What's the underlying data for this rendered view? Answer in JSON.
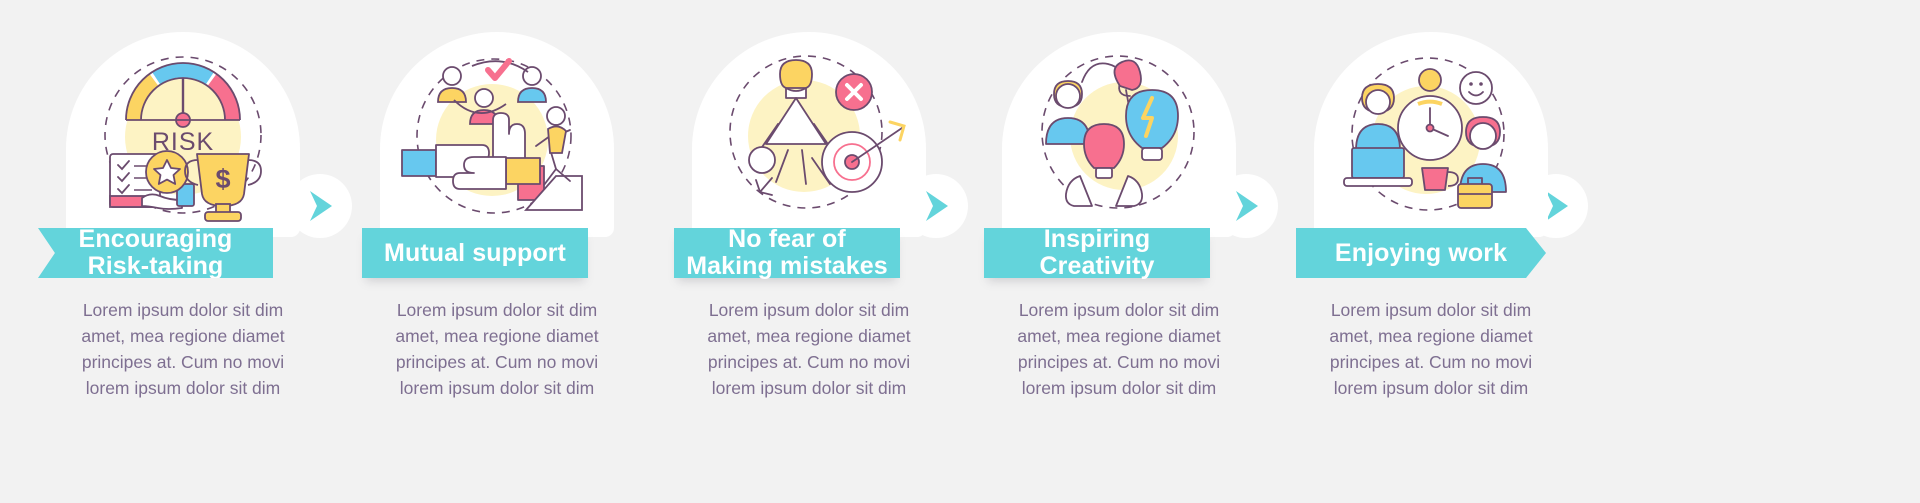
{
  "background_color": "#f2f2f2",
  "theme": {
    "accent_teal": "#63d4db",
    "banner_text_color": "#ffffff",
    "body_text_color": "#7e6f91",
    "card_color": "#ffffff",
    "yellow": "#fcd462",
    "pink": "#f7708f",
    "blue": "#67c8ef",
    "outline": "#6b4b6e",
    "soft_yellow": "#fdf3c4"
  },
  "shared": {
    "body_text": "Lorem ipsum dolor sit dim amet, mea regione diamet principes at. Cum no movi lorem ipsum dolor sit dim"
  },
  "steps": [
    {
      "index": 1,
      "label_lines": [
        "Encouraging",
        "Risk-taking"
      ],
      "label_plain": "Encouraging Risk-taking",
      "icon_name": "risk-gauge-trophy-illustration",
      "icon_caption": "RISK",
      "banner_shape": "left-notch",
      "body_text": "Lorem ipsum dolor sit dim amet, mea regione diamet principes at. Cum no movi lorem ipsum dolor sit dim"
    },
    {
      "index": 2,
      "label_lines": [
        "Mutual support"
      ],
      "label_plain": "Mutual support",
      "icon_name": "teamwork-hands-illustration",
      "icon_caption": "",
      "banner_shape": "rect",
      "body_text": "Lorem ipsum dolor sit dim amet, mea regione diamet principes at. Cum no movi lorem ipsum dolor sit dim"
    },
    {
      "index": 3,
      "label_lines": [
        "No fear of",
        "Making mistakes"
      ],
      "label_plain": "No fear of Making mistakes",
      "icon_name": "mistake-target-person-illustration",
      "icon_caption": "",
      "banner_shape": "rect",
      "body_text": "Lorem ipsum dolor sit dim amet, mea regione diamet principes at. Cum no movi lorem ipsum dolor sit dim"
    },
    {
      "index": 4,
      "label_lines": [
        "Inspiring",
        "Creativity"
      ],
      "label_plain": "Inspiring Creativity",
      "icon_name": "lightbulb-creativity-illustration",
      "icon_caption": "",
      "banner_shape": "rect",
      "body_text": "Lorem ipsum dolor sit dim amet, mea regione diamet principes at. Cum no movi lorem ipsum dolor sit dim"
    },
    {
      "index": 5,
      "label_lines": [
        "Enjoying work"
      ],
      "label_plain": "Enjoying work",
      "icon_name": "happy-worker-desk-illustration",
      "icon_caption": "",
      "banner_shape": "right-point",
      "body_text": "Lorem ipsum dolor sit dim amet, mea regione diamet principes at. Cum no movi lorem ipsum dolor sit dim"
    }
  ],
  "connectors": [
    {
      "index": 1,
      "icon_name": "chevron-right-icon"
    },
    {
      "index": 2,
      "icon_name": "chevron-right-icon"
    },
    {
      "index": 3,
      "icon_name": "chevron-right-icon"
    },
    {
      "index": 4,
      "icon_name": "chevron-right-icon"
    }
  ]
}
